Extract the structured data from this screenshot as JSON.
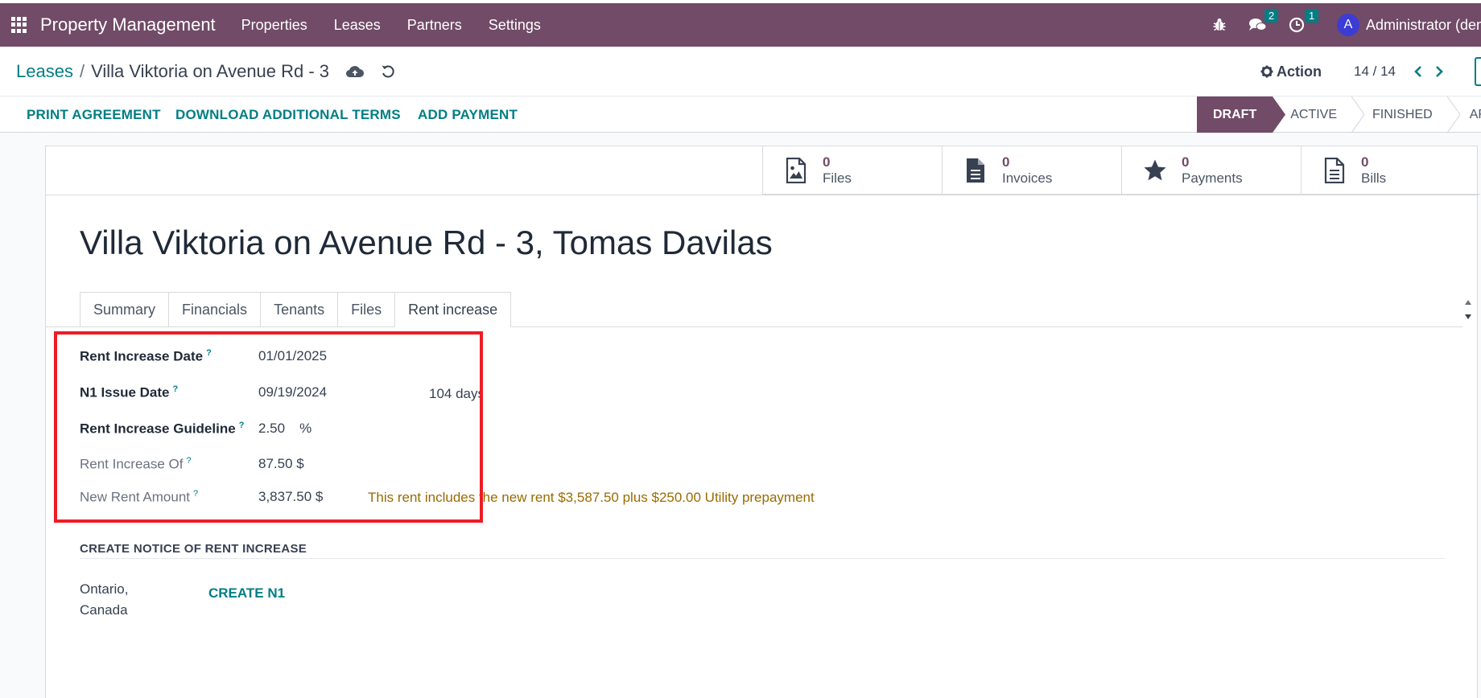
{
  "topbar": {
    "app_name": "Property Management",
    "menu": [
      "Properties",
      "Leases",
      "Partners",
      "Settings"
    ],
    "messages_count": "2",
    "activities_count": "1",
    "avatar_letter": "A",
    "user_name": "Administrator (dem"
  },
  "control": {
    "breadcrumb_parent": "Leases",
    "breadcrumb_separator": "/",
    "breadcrumb_current": "Villa Viktoria on Avenue Rd - 3",
    "action_label": "Action",
    "pager": "14 / 14"
  },
  "statusbar": {
    "buttons": [
      "PRINT AGREEMENT",
      "DOWNLOAD ADDITIONAL TERMS",
      "ADD PAYMENT"
    ],
    "stages": [
      "DRAFT",
      "ACTIVE",
      "FINISHED",
      "ARCHI"
    ],
    "active_stage": "DRAFT"
  },
  "smart_buttons": [
    {
      "count": "0",
      "label": "Files",
      "icon": "image-file-icon"
    },
    {
      "count": "0",
      "label": "Invoices",
      "icon": "invoice-file-icon"
    },
    {
      "count": "0",
      "label": "Payments",
      "icon": "star-icon"
    },
    {
      "count": "0",
      "label": "Bills",
      "icon": "bill-file-icon"
    }
  ],
  "record": {
    "title": "Villa Viktoria on Avenue Rd - 3, Tomas Davilas"
  },
  "tabs": [
    "Summary",
    "Financials",
    "Tenants",
    "Files",
    "Rent increase"
  ],
  "active_tab": "Rent increase",
  "rent_increase": {
    "help_mark": "?",
    "increase_date_label": "Rent Increase Date",
    "increase_date_value": "01/01/2025",
    "n1_issue_label": "N1 Issue Date",
    "n1_issue_value": "09/19/2024",
    "n1_days": "104 days",
    "guideline_label": "Rent Increase Guideline",
    "guideline_value": "2.50",
    "guideline_unit": "%",
    "increase_of_label": "Rent Increase Of",
    "increase_of_value": "87.50 $",
    "new_rent_label": "New Rent Amount",
    "new_rent_value": "3,837.50 $",
    "new_rent_note": "This rent includes the new rent $3,587.50 plus $250.00 Utility prepayment"
  },
  "notice": {
    "section_title": "CREATE NOTICE OF RENT INCREASE",
    "location": "Ontario, Canada",
    "create_button": "CREATE N1"
  },
  "colors": {
    "brand": "#714b67",
    "accent": "#017e84",
    "highlight": "#ee1c25",
    "note": "#9a6b00"
  }
}
